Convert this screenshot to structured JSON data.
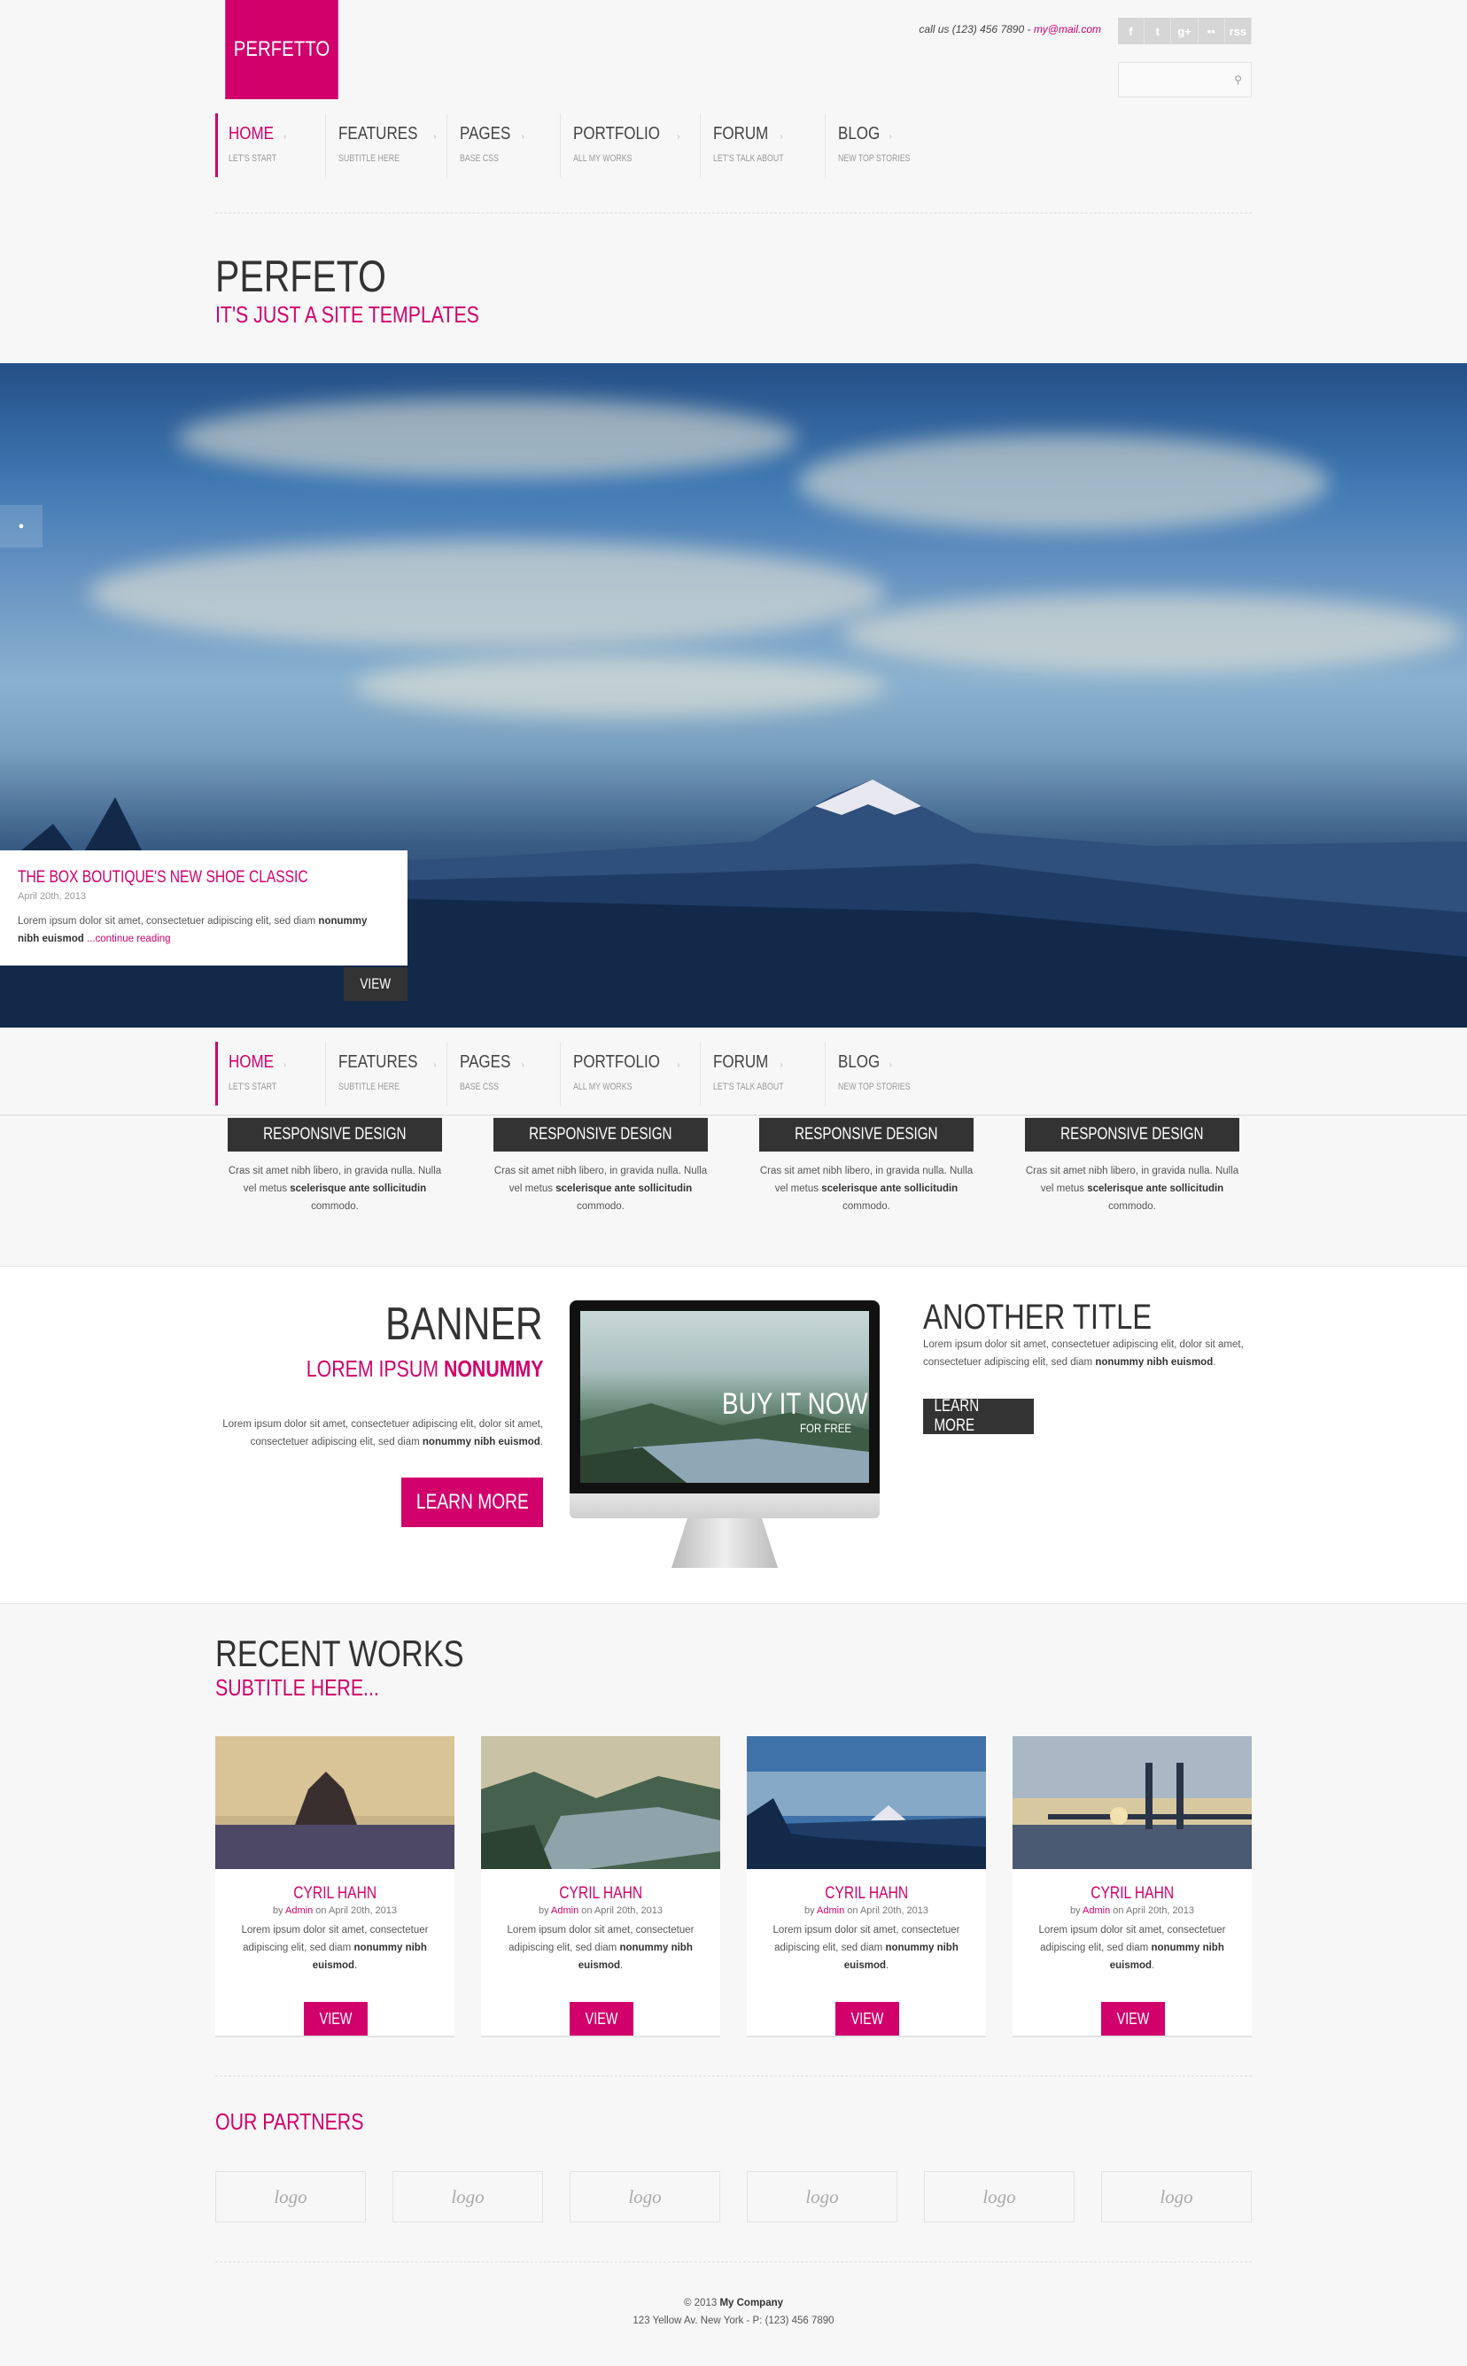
{
  "header": {
    "logo": "PERFETTO",
    "contact_label": "call us (123) 456 7890 - ",
    "contact_email": "my@mail.com",
    "social": [
      "f",
      "t",
      "g+",
      "••",
      "rss"
    ],
    "search_placeholder": ""
  },
  "nav": [
    {
      "label": "HOME",
      "sub": "LET'S START"
    },
    {
      "label": "FEATURES",
      "sub": "SUBTITLE HERE"
    },
    {
      "label": "PAGES",
      "sub": "BASE CSS"
    },
    {
      "label": "PORTFOLIO",
      "sub": "ALL MY WORKS"
    },
    {
      "label": "FORUM",
      "sub": "LET'S TALK ABOUT"
    },
    {
      "label": "BLOG",
      "sub": "NEW TOP STORIES"
    }
  ],
  "hero": {
    "title": "PERFETO",
    "subtitle": "IT'S JUST A SITE TEMPLATES"
  },
  "slider": {
    "caption_title": "THE BOX BOUTIQUE'S NEW SHOE CLASSIC",
    "caption_date": "April 20th, 2013",
    "caption_text": "Lorem ipsum dolor sit amet, consectetuer adipiscing elit, sed diam ",
    "caption_bold": "nonummy nibh euismod",
    "caption_link": " ...continue reading",
    "view_label": "VIEW"
  },
  "features": [
    {
      "tag": "RESPONSIVE DESIGN",
      "text": "Cras sit amet nibh libero, in gravida nulla. Nulla vel metus ",
      "bold": "scelerisque ante sollicitudin",
      "end": " commodo."
    },
    {
      "tag": "RESPONSIVE DESIGN",
      "text": "Cras sit amet nibh libero, in gravida nulla. Nulla vel metus ",
      "bold": "scelerisque ante sollicitudin",
      "end": " commodo."
    },
    {
      "tag": "RESPONSIVE DESIGN",
      "text": "Cras sit amet nibh libero, in gravida nulla. Nulla vel metus ",
      "bold": "scelerisque ante sollicitudin",
      "end": " commodo."
    },
    {
      "tag": "RESPONSIVE DESIGN",
      "text": "Cras sit amet nibh libero, in gravida nulla. Nulla vel metus ",
      "bold": "scelerisque ante sollicitudin",
      "end": " commodo."
    }
  ],
  "banner": {
    "title": "BANNER",
    "sub_plain": "LOREM IPSUM ",
    "sub_bold": "NONUMMY",
    "text": "Lorem ipsum dolor sit amet, consectetuer adipiscing elit, dolor sit amet, consectetuer adipiscing elit, sed diam ",
    "bold": "nonummy nibh euismod",
    "end": ".",
    "button": "LEARN MORE",
    "screen_title": "BUY IT NOW",
    "screen_sub": "FOR FREE"
  },
  "another": {
    "title": "ANOTHER TITLE",
    "text": "Lorem ipsum dolor sit amet, consectetuer adipiscing elit, dolor sit amet, consectetuer adipiscing elit, sed diam ",
    "bold": "nonummy nibh euismod",
    "end": ".",
    "button": "LEARN MORE"
  },
  "recent": {
    "title": "RECENT WORKS",
    "subtitle": "SUBTITLE HERE...",
    "cards": [
      {
        "name": "CYRIL HAHN",
        "by": "by ",
        "author": "Admin",
        "date": " on April 20th, 2013",
        "text": "Lorem ipsum dolor sit amet, consectetuer adipiscing elit, sed diam ",
        "bold": "nonummy nibh euismod",
        "end": ".",
        "button": "VIEW"
      },
      {
        "name": "CYRIL HAHN",
        "by": "by ",
        "author": "Admin",
        "date": " on April 20th, 2013",
        "text": "Lorem ipsum dolor sit amet, consectetuer adipiscing elit, sed diam ",
        "bold": "nonummy nibh euismod",
        "end": ".",
        "button": "VIEW"
      },
      {
        "name": "CYRIL HAHN",
        "by": "by ",
        "author": "Admin",
        "date": " on April 20th, 2013",
        "text": "Lorem ipsum dolor sit amet, consectetuer adipiscing elit, sed diam ",
        "bold": "nonummy nibh euismod",
        "end": ".",
        "button": "VIEW"
      },
      {
        "name": "CYRIL HAHN",
        "by": "by ",
        "author": "Admin",
        "date": " on April 20th, 2013",
        "text": "Lorem ipsum dolor sit amet, consectetuer adipiscing elit, sed diam ",
        "bold": "nonummy nibh euismod",
        "end": ".",
        "button": "VIEW"
      }
    ]
  },
  "partners": {
    "title": "OUR PARTNERS",
    "logos": [
      "logo",
      "logo",
      "logo",
      "logo",
      "logo",
      "logo"
    ]
  },
  "footer": {
    "copy": "© 2013 ",
    "company": "My Company",
    "address": "123 Yellow Av. New York - P: (123) 456 7890"
  },
  "colors": {
    "accent": "#d1006b",
    "dark": "#333333"
  }
}
